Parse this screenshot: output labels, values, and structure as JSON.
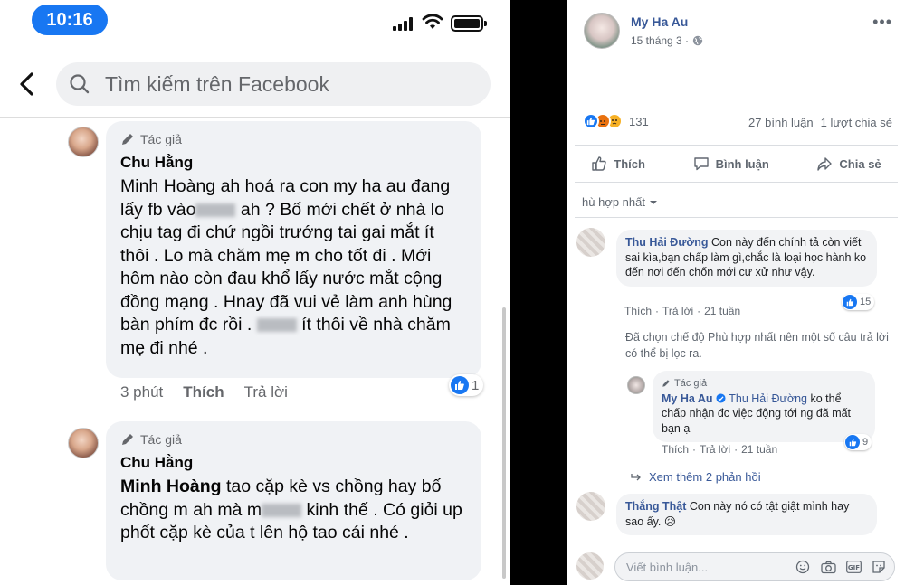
{
  "mobile": {
    "status_time": "10:16",
    "search": {
      "placeholder": "Tìm kiếm trên Facebook"
    },
    "comments": [
      {
        "author_tag": "Tác giả",
        "name": "Chu Hằng",
        "mention": "",
        "text_parts": [
          "Minh Hoàng ah hoá ra con my ha au đang lấy fb vào",
          "ah ? Bố mới chết ở nhà lo chịu tag đi chứ ngồi trướng tai gai mắt ít thôi . Lo mà chăm mẹ m cho tốt đi . Mới hôm nào còn đau khổ lấy nước mắt cộng đồng mạng . Hnay đã vui vẻ làm anh hùng bàn phím đc rồi .",
          "ít thôi về nhà chăm mẹ đi nhé ."
        ],
        "time": "3 phút",
        "like": "Thích",
        "reply": "Trả lời",
        "reaction_count": "1"
      },
      {
        "author_tag": "Tác giả",
        "name": "Chu Hằng",
        "mention": "Minh Hoàng",
        "text_parts": [
          "tao cặp kè vs chồng hay bố chồng m ah mà m",
          "kinh thế . Có giỏi up phốt cặp kè của t lên hộ tao cái nhé ."
        ]
      }
    ]
  },
  "post": {
    "author": "My Ha Au",
    "date": "15 tháng 3 ·",
    "reaction_count": "131",
    "comments_count": "27 bình luận",
    "shares_count": "1 lượt chia sẻ",
    "actions": {
      "like": "Thích",
      "comment": "Bình luận",
      "share": "Chia sẻ"
    },
    "filter_label": "hù hợp nhất",
    "comments": [
      {
        "name": "Thu Hải Đường",
        "text": "Con này đến chính tả còn viết sai kìa,bạn chấp làm gì,chắc là loại học hành ko đến nơi đến chốn mới cư xử như vậy.",
        "like": "Thích",
        "reply": "Trả lời",
        "time": "21 tuần",
        "reactions": "15"
      },
      {
        "filter_note": "Đã chọn chế độ Phù hợp nhất nên một số câu trả lời có thể bị lọc ra."
      },
      {
        "author_tag": "Tác giả",
        "name": "My Ha Au",
        "mention": "Thu Hải Đường",
        "text": "ko thể chấp nhận đc việc động tới ng đã mất bạn ạ",
        "like": "Thích",
        "reply": "Trả lời",
        "time": "21 tuần",
        "reactions": "9"
      },
      {
        "more_replies": "Xem thêm 2 phản hồi"
      },
      {
        "name": "Thắng Thật",
        "text": "Con này nó có tật giật mình hay sao ấy.",
        "emoji": "😥"
      }
    ],
    "write_placeholder": "Viết bình luận..."
  }
}
